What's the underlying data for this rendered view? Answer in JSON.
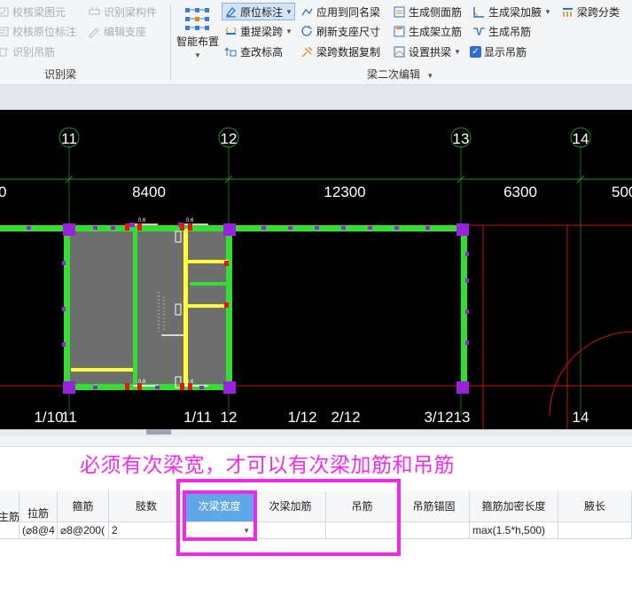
{
  "ribbon": {
    "group1": {
      "label": "识别梁",
      "items": [
        {
          "label": "校核梁图元",
          "icon": "check-beam-icon"
        },
        {
          "label": "校核原位标注",
          "icon": "check-annotation-icon"
        },
        {
          "label": "识别吊筋",
          "icon": "identify-hanger-icon"
        },
        {
          "label": "识别梁构件",
          "icon": "identify-beam-component-icon"
        },
        {
          "label": "编辑支座",
          "icon": "edit-support-icon"
        }
      ]
    },
    "group2": {
      "label": "梁二次编辑",
      "smart_layout": "智能布置",
      "items": [
        {
          "label": "原位标注",
          "icon": "in-place-annotation-icon"
        },
        {
          "label": "重提梁跨",
          "icon": "re-extract-span-icon"
        },
        {
          "label": "查改标高",
          "icon": "elevation-icon"
        },
        {
          "label": "应用到同名梁",
          "icon": "apply-same-name-icon"
        },
        {
          "label": "刷新支座尺寸",
          "icon": "refresh-support-icon"
        },
        {
          "label": "梁跨数据复制",
          "icon": "copy-span-data-icon"
        },
        {
          "label": "生成侧面筋",
          "icon": "side-rebar-icon"
        },
        {
          "label": "生成架立筋",
          "icon": "erection-rebar-icon"
        },
        {
          "label": "设置拱梁",
          "icon": "arch-beam-icon"
        },
        {
          "label": "生成梁加腋",
          "icon": "haunch-icon"
        },
        {
          "label": "生成吊筋",
          "icon": "hanger-rebar-icon"
        },
        {
          "label": "显示吊筋",
          "icon": "checkbox-checked-icon"
        },
        {
          "label": "梁跨分类",
          "icon": "span-classify-icon"
        }
      ]
    }
  },
  "canvas": {
    "axis_labels": [
      "11",
      "12",
      "13",
      "14"
    ],
    "dimensions": [
      "0",
      "8400",
      "12300",
      "6300",
      "500"
    ],
    "bottom_labels": [
      "1/10",
      "11",
      "1/11",
      "12",
      "1/12",
      "2/12",
      "3/12",
      "13",
      "14"
    ],
    "small_text": [
      "0.6",
      "0.6",
      "0.6",
      "0.6"
    ]
  },
  "annotation": "必须有次梁宽，才可以有次梁加筋和吊筋",
  "grid": {
    "columns": [
      {
        "header": "主筋",
        "value": ""
      },
      {
        "header": "拉筋",
        "value": "(⌀8@4"
      },
      {
        "header": "箍筋",
        "value": "⌀8@200("
      },
      {
        "header": "肢数",
        "value": "2"
      },
      {
        "header": "次梁宽度",
        "value": ""
      },
      {
        "header": "次梁加筋",
        "value": ""
      },
      {
        "header": "吊筋",
        "value": ""
      },
      {
        "header": "吊筋锚固",
        "value": ""
      },
      {
        "header": "箍筋加密长度",
        "value": "max(1.5*h,500)"
      },
      {
        "header": "腋长",
        "value": ""
      }
    ]
  },
  "colors": {
    "highlight": "#ee2ae8",
    "active_header": "#5ea8ea",
    "beam_green": "#33dd33",
    "beam_yellow": "#ffff33",
    "support_purple": "#9922dd"
  }
}
